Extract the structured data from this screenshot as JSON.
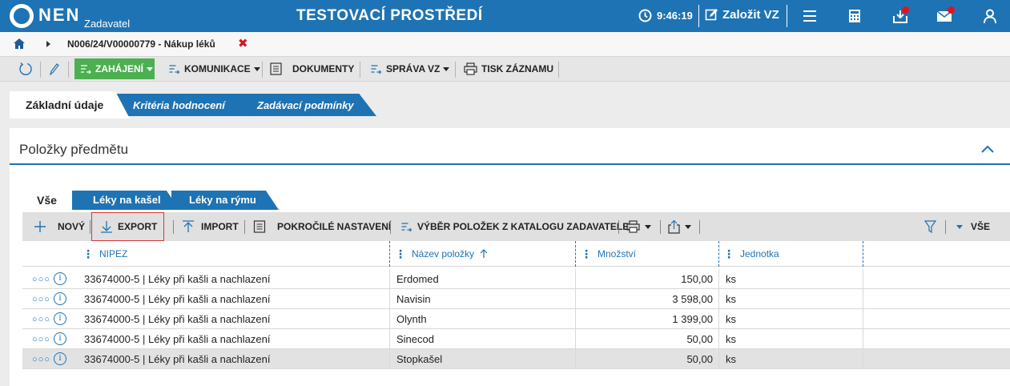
{
  "header": {
    "logo_text": "NEN",
    "logo_sub": "Zadavatel",
    "environment_title": "TESTOVACÍ PROSTŘEDÍ",
    "clock": "9:46:19",
    "create_label": "Založit VZ",
    "icons": [
      "clock-icon",
      "edit-icon",
      "menu-icon",
      "calculator-icon",
      "inbox-icon",
      "mail-icon",
      "user-icon"
    ],
    "brand_color": "#1e73b4",
    "notification_color": "#e3121b"
  },
  "breadcrumb": {
    "path": "N006/24/V00000779 - Nákup léků",
    "close_symbol": "✖"
  },
  "actions": {
    "start_label": "ZAHÁJENÍ",
    "communication_label": "KOMUNIKACE",
    "documents_label": "DOKUMENTY",
    "management_label": "SPRÁVA VZ",
    "print_label": "TISK ZÁZNAMU",
    "start_color": "#4caf50"
  },
  "tabs": [
    "Základní údaje",
    "Kritéria hodnocení",
    "Zadávací podmínky"
  ],
  "section": {
    "title": "Položky předmětu",
    "subtabs": [
      "Vše",
      "Léky na kašel",
      "Léky na rýmu"
    ]
  },
  "grid_toolbar": {
    "new_label": "NOVÝ",
    "export_label": "EXPORT",
    "import_label": "IMPORT",
    "advanced_label": "POKROČILÉ NASTAVENÍ",
    "catalog_label": "VÝBĚR POLOŽEK Z KATALOGU ZADAVATELE",
    "filter_label": "VŠE"
  },
  "table": {
    "columns": [
      "NIPEZ",
      "Název položky",
      "Množství",
      "Jednotka"
    ],
    "rows": [
      {
        "nipez": "33674000-5 | Léky při kašli a nachlazení",
        "name": "Erdomed",
        "qty": "150,00",
        "unit": "ks"
      },
      {
        "nipez": "33674000-5 | Léky při kašli a nachlazení",
        "name": "Navisin",
        "qty": "3 598,00",
        "unit": "ks"
      },
      {
        "nipez": "33674000-5 | Léky při kašli a nachlazení",
        "name": "Olynth",
        "qty": "1 399,00",
        "unit": "ks"
      },
      {
        "nipez": "33674000-5 | Léky při kašli a nachlazení",
        "name": "Sinecod",
        "qty": "50,00",
        "unit": "ks"
      },
      {
        "nipez": "33674000-5 | Léky při kašli a nachlazení",
        "name": "Stopkašel",
        "qty": "50,00",
        "unit": "ks"
      }
    ]
  }
}
